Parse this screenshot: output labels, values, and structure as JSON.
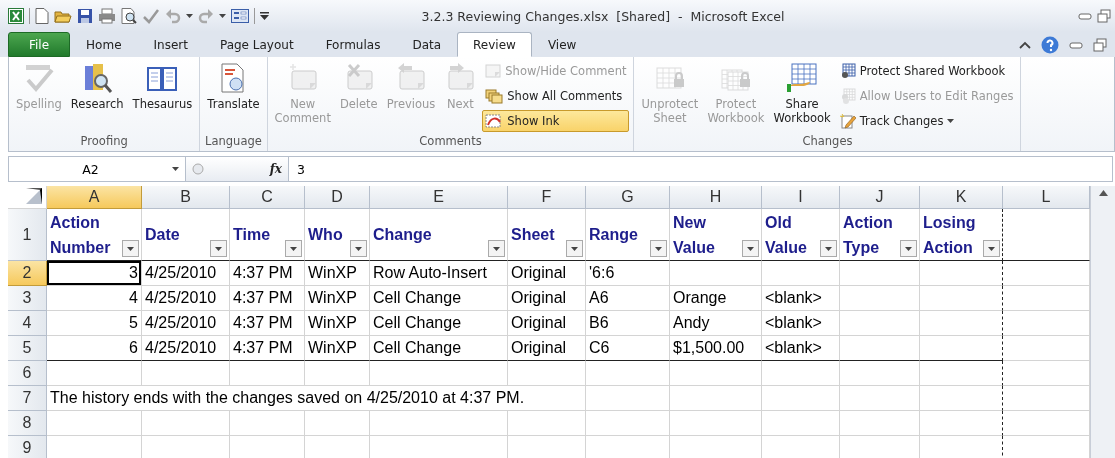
{
  "window": {
    "title": "3.2.3 Reviewing Changes.xlsx  [Shared]  -  Microsoft Excel"
  },
  "tabs": [
    {
      "label": "File",
      "kind": "file",
      "selected": false
    },
    {
      "label": "Home",
      "kind": "tab",
      "selected": false
    },
    {
      "label": "Insert",
      "kind": "tab",
      "selected": false
    },
    {
      "label": "Page Layout",
      "kind": "tab",
      "selected": false
    },
    {
      "label": "Formulas",
      "kind": "tab",
      "selected": false
    },
    {
      "label": "Data",
      "kind": "tab",
      "selected": false
    },
    {
      "label": "Review",
      "kind": "tab",
      "selected": true
    },
    {
      "label": "View",
      "kind": "tab",
      "selected": false
    }
  ],
  "ribbon": {
    "groups": [
      {
        "label": "Proofing",
        "items": [
          {
            "label": "Spelling",
            "kind": "large",
            "disabled": true,
            "pressed": false,
            "dropdown": false
          },
          {
            "label": "Research",
            "kind": "large",
            "disabled": false,
            "pressed": false,
            "dropdown": false
          },
          {
            "label": "Thesaurus",
            "kind": "large",
            "disabled": false,
            "pressed": false,
            "dropdown": false
          }
        ]
      },
      {
        "label": "Language",
        "items": [
          {
            "label": "Translate",
            "kind": "large",
            "disabled": false,
            "pressed": false,
            "dropdown": false
          }
        ]
      },
      {
        "label": "Comments",
        "items": [
          {
            "label": "New Comment",
            "kind": "large",
            "disabled": true,
            "pressed": false,
            "dropdown": false
          },
          {
            "label": "Delete",
            "kind": "large",
            "disabled": true,
            "pressed": false,
            "dropdown": false
          },
          {
            "label": "Previous",
            "kind": "large",
            "disabled": true,
            "pressed": false,
            "dropdown": false
          },
          {
            "label": "Next",
            "kind": "large",
            "disabled": true,
            "pressed": false,
            "dropdown": false
          },
          {
            "label": "Show/Hide Comment",
            "kind": "small",
            "disabled": true,
            "pressed": false,
            "dropdown": false
          },
          {
            "label": "Show All Comments",
            "kind": "small",
            "disabled": false,
            "pressed": false,
            "dropdown": false
          },
          {
            "label": "Show Ink",
            "kind": "small",
            "disabled": false,
            "pressed": true,
            "dropdown": false
          }
        ]
      },
      {
        "label": "Changes",
        "items": [
          {
            "label": "Unprotect Sheet",
            "kind": "large",
            "disabled": true,
            "pressed": false,
            "dropdown": false
          },
          {
            "label": "Protect Workbook",
            "kind": "large",
            "disabled": true,
            "pressed": false,
            "dropdown": false
          },
          {
            "label": "Share Workbook",
            "kind": "large",
            "disabled": false,
            "pressed": false,
            "dropdown": false
          },
          {
            "label": "Protect Shared Workbook",
            "kind": "small",
            "disabled": false,
            "pressed": false,
            "dropdown": false
          },
          {
            "label": "Allow Users to Edit Ranges",
            "kind": "small",
            "disabled": true,
            "pressed": false,
            "dropdown": false
          },
          {
            "label": "Track Changes",
            "kind": "small",
            "disabled": false,
            "pressed": false,
            "dropdown": true
          }
        ]
      }
    ]
  },
  "formula_bar": {
    "name_box": "A2",
    "function_symbol": "fx",
    "formula": "3"
  },
  "sheet": {
    "columns": [
      {
        "letter": "A",
        "selected": true
      },
      {
        "letter": "B",
        "selected": false
      },
      {
        "letter": "C",
        "selected": false
      },
      {
        "letter": "D",
        "selected": false
      },
      {
        "letter": "E",
        "selected": false
      },
      {
        "letter": "F",
        "selected": false
      },
      {
        "letter": "G",
        "selected": false
      },
      {
        "letter": "H",
        "selected": false
      },
      {
        "letter": "I",
        "selected": false
      },
      {
        "letter": "J",
        "selected": false
      },
      {
        "letter": "K",
        "selected": false
      },
      {
        "letter": "L",
        "selected": false
      }
    ],
    "header_row": {
      "number": "1",
      "selected": false,
      "headers": [
        "Action Number",
        "Date",
        "Time",
        "Who",
        "Change",
        "Sheet",
        "Range",
        "New Value",
        "Old Value",
        "Action Type",
        "Losing Action"
      ]
    },
    "rows": [
      {
        "number": "2",
        "selected": true,
        "action_number": "3",
        "date": "4/25/2010",
        "time": "4:37 PM",
        "who": "WinXP",
        "change": "Row Auto-Insert",
        "sheet": "Original",
        "range": "'6:6"
      },
      {
        "number": "3",
        "selected": false,
        "action_number": "4",
        "date": "4/25/2010",
        "time": "4:37 PM",
        "who": "WinXP",
        "change": "Cell Change",
        "sheet": "Original",
        "range": "A6",
        "new_value": "Orange",
        "old_value": "<blank>"
      },
      {
        "number": "4",
        "selected": false,
        "action_number": "5",
        "date": "4/25/2010",
        "time": "4:37 PM",
        "who": "WinXP",
        "change": "Cell Change",
        "sheet": "Original",
        "range": "B6",
        "new_value": "Andy",
        "old_value": "<blank>"
      },
      {
        "number": "5",
        "selected": false,
        "action_number": "6",
        "date": "4/25/2010",
        "time": "4:37 PM",
        "who": "WinXP",
        "change": "Cell Change",
        "sheet": "Original",
        "range": "C6",
        "new_value": "$1,500.00",
        "old_value": "<blank>"
      },
      {
        "number": "6",
        "selected": false
      },
      {
        "number": "7",
        "selected": false,
        "note": "The history ends with the changes saved on 4/25/2010 at 4:37 PM."
      },
      {
        "number": "8",
        "selected": false
      },
      {
        "number": "9",
        "selected": false
      }
    ]
  }
}
